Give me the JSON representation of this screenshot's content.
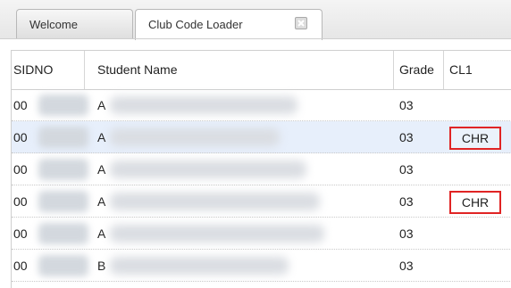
{
  "tabs": [
    {
      "label": "Welcome",
      "active": false
    },
    {
      "label": "Club Code Loader",
      "active": true,
      "closable": true
    }
  ],
  "grid": {
    "columns": [
      "SIDNO",
      "Student Name",
      "Grade",
      "CL1"
    ],
    "rows": [
      {
        "sidno": "00",
        "name": "A",
        "grade": "03",
        "cl1": ""
      },
      {
        "sidno": "00",
        "name": "A",
        "grade": "03",
        "cl1": "CHR",
        "selected": true
      },
      {
        "sidno": "00",
        "name": "A",
        "grade": "03",
        "cl1": ""
      },
      {
        "sidno": "00",
        "name": "A",
        "grade": "03",
        "cl1": "CHR"
      },
      {
        "sidno": "00",
        "name": "A",
        "grade": "03",
        "cl1": ""
      },
      {
        "sidno": "00",
        "name": "B",
        "grade": "03",
        "cl1": ""
      }
    ]
  },
  "colors": {
    "highlight_border": "#e02424",
    "selected_row": "#e7effb"
  }
}
